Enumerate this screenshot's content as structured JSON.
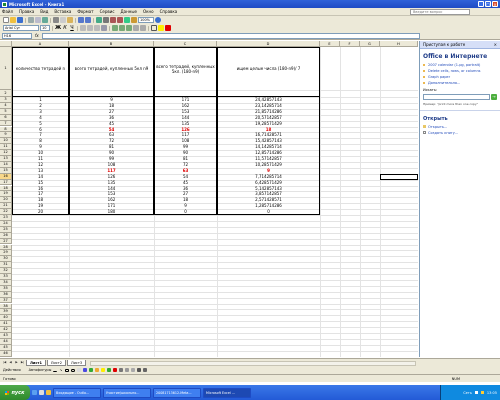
{
  "window": {
    "title": "Microsoft Excel - Книга1",
    "help_placeholder": "Введите вопрос"
  },
  "menu": [
    "Файл",
    "Правка",
    "Вид",
    "Вставка",
    "Формат",
    "Сервис",
    "Данные",
    "Окно",
    "Справка"
  ],
  "toolbar": {
    "zoom": "100%",
    "font": "Arial Cyr",
    "size": "10"
  },
  "formula_bar": {
    "name_box": "H16",
    "fx": "fx",
    "value": ""
  },
  "columns": [
    "A",
    "B",
    "C",
    "D",
    "E",
    "F",
    "G",
    "H"
  ],
  "rows": [
    "1",
    "2",
    "3",
    "4",
    "5",
    "6",
    "7",
    "8",
    "9",
    "10",
    "11",
    "12",
    "13",
    "14",
    "15",
    "16",
    "17",
    "18",
    "19",
    "20",
    "21",
    "22",
    "23",
    "24",
    "25",
    "26",
    "27",
    "28",
    "29",
    "30",
    "31",
    "32",
    "33",
    "34",
    "35",
    "36",
    "37",
    "38",
    "39",
    "40",
    "41",
    "42",
    "43",
    "44",
    "45",
    "46",
    "47",
    "48",
    "49",
    "50",
    "51",
    "52",
    "53"
  ],
  "table": {
    "headers": [
      "количество тетрадей n",
      "всего тетрадей, купленных 5кл n9",
      "всего тетрадей, купленных 5кл. (180-n9)",
      "ищем целые числа (180-n9)/ 7"
    ],
    "rows": [
      [
        "1",
        "9",
        "171",
        "24,42857143"
      ],
      [
        "2",
        "18",
        "162",
        "23,14285714"
      ],
      [
        "3",
        "27",
        "153",
        "21,85714286"
      ],
      [
        "4",
        "36",
        "144",
        "20,57142857"
      ],
      [
        "5",
        "45",
        "135",
        "19,28571429"
      ],
      [
        "6",
        "54",
        "126",
        "18"
      ],
      [
        "7",
        "63",
        "117",
        "16,71428571"
      ],
      [
        "8",
        "72",
        "108",
        "15,42857143"
      ],
      [
        "9",
        "81",
        "99",
        "14,14285714"
      ],
      [
        "10",
        "90",
        "90",
        "12,85714286"
      ],
      [
        "11",
        "99",
        "81",
        "11,57142857"
      ],
      [
        "12",
        "108",
        "72",
        "10,28571429"
      ],
      [
        "13",
        "117",
        "63",
        "9"
      ],
      [
        "14",
        "126",
        "54",
        "7,714285714"
      ],
      [
        "15",
        "135",
        "45",
        "6,428571429"
      ],
      [
        "16",
        "144",
        "36",
        "5,142857143"
      ],
      [
        "17",
        "153",
        "27",
        "3,857142857"
      ],
      [
        "18",
        "162",
        "18",
        "2,571428571"
      ],
      [
        "19",
        "171",
        "9",
        "1,285714286"
      ],
      [
        "20",
        "180",
        "0",
        "0"
      ]
    ],
    "highlight_rows": [
      5,
      12
    ]
  },
  "task_pane": {
    "header": "Приступая к работе",
    "title": "Office в Интернете",
    "links": [
      "2007 calendar (1-pg, portrait)",
      "Delete cells, rows, or columns",
      "Graph paper",
      "Дополнительно..."
    ],
    "search_label": "Искать:",
    "example": "Пример: \"print more than one copy\"",
    "open_title": "Открыть",
    "open_links": [
      "Открыть...",
      "Создать книгу..."
    ]
  },
  "sheet_tabs": [
    "Лист1",
    "Лист2",
    "Лист3"
  ],
  "drawbar": {
    "actions": "Действия",
    "autoshapes": "Автофигуры"
  },
  "status": {
    "ready": "Готово",
    "num": "NUM"
  },
  "taskbar": {
    "start": "пуск",
    "tasks": [
      "Входящие - Outlo...",
      "Участие/школьно...",
      "20081713612-Meta...",
      "Microsoft Excel ..."
    ],
    "tray_text": "Сеть",
    "clock": "13:05"
  }
}
